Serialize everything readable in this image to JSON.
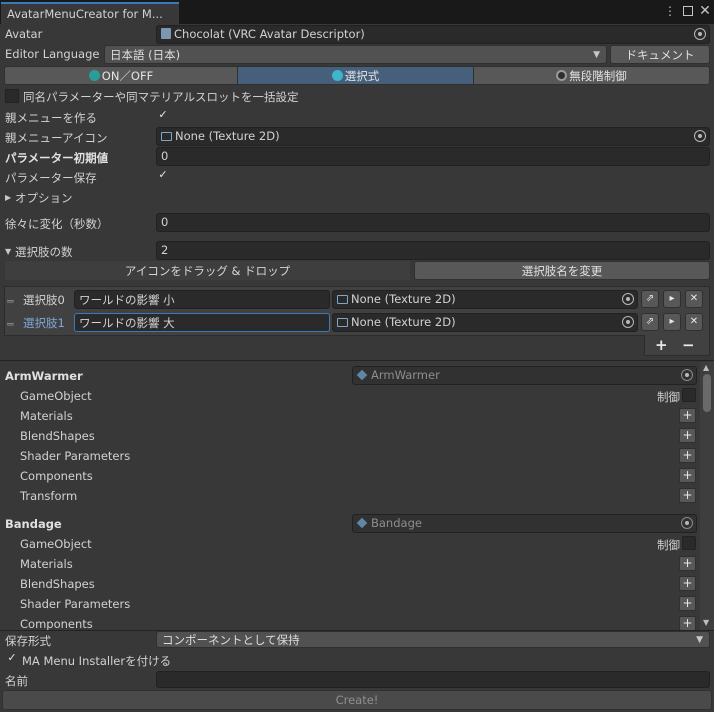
{
  "window": {
    "tab_title": "AvatarMenuCreator for M...",
    "menu_icon": "kebab-menu-icon",
    "maximize_icon": "maximize-icon",
    "close_icon": "close-icon"
  },
  "avatar": {
    "label": "Avatar",
    "value": "Chocolat (VRC Avatar Descriptor)"
  },
  "editor_language": {
    "label": "Editor Language",
    "value": "日本語 (日本)",
    "doc_button": "ドキュメント"
  },
  "mode_tabs": [
    {
      "label": "ON／OFF",
      "active": false,
      "icon_color": "#2a9d9a"
    },
    {
      "label": "選択式",
      "active": true,
      "icon_color": "#3fb6c9"
    },
    {
      "label": "無段階制御",
      "active": false,
      "icon_color": "#2f2f2f"
    }
  ],
  "bulk_setting_label": "同名パラメーターや同マテリアルスロットを一括設定",
  "parent_menu": {
    "label": "親メニューを作る",
    "checked": true
  },
  "parent_icon": {
    "label": "親メニューアイコン",
    "value": "None (Texture 2D)"
  },
  "param_default": {
    "label": "パラメーター初期値",
    "value": "0"
  },
  "param_save": {
    "label": "パラメーター保存",
    "checked": true
  },
  "options_label": "オプション",
  "gradual": {
    "label": "徐々に変化（秒数）",
    "value": "0"
  },
  "choice_count": {
    "label": "選択肢の数",
    "value": "2"
  },
  "drag_drop_label": "アイコンをドラッグ & ドロップ",
  "rename_button": "選択肢名を変更",
  "choices": [
    {
      "label": "選択肢0",
      "name": "ワールドの影響 小",
      "icon": "None (Texture 2D)",
      "selected": false
    },
    {
      "label": "選択肢1",
      "name": "ワールドの影響 大",
      "icon": "None (Texture 2D)",
      "selected": true
    }
  ],
  "list_add": "+",
  "list_remove": "−",
  "groups": [
    {
      "title": "ArmWarmer",
      "object": "ArmWarmer",
      "control_label": "制御",
      "items": [
        "GameObject",
        "Materials",
        "BlendShapes",
        "Shader Parameters",
        "Components",
        "Transform"
      ]
    },
    {
      "title": "Bandage",
      "object": "Bandage",
      "control_label": "制御",
      "items": [
        "GameObject",
        "Materials",
        "BlendShapes",
        "Shader Parameters",
        "Components"
      ]
    }
  ],
  "save_format": {
    "label": "保存形式",
    "value": "コンポーネントとして保持"
  },
  "ma_installer": {
    "label": "MA Menu Installerを付ける",
    "checked": true
  },
  "name_field": {
    "label": "名前",
    "value": ""
  },
  "create_button": "Create!"
}
